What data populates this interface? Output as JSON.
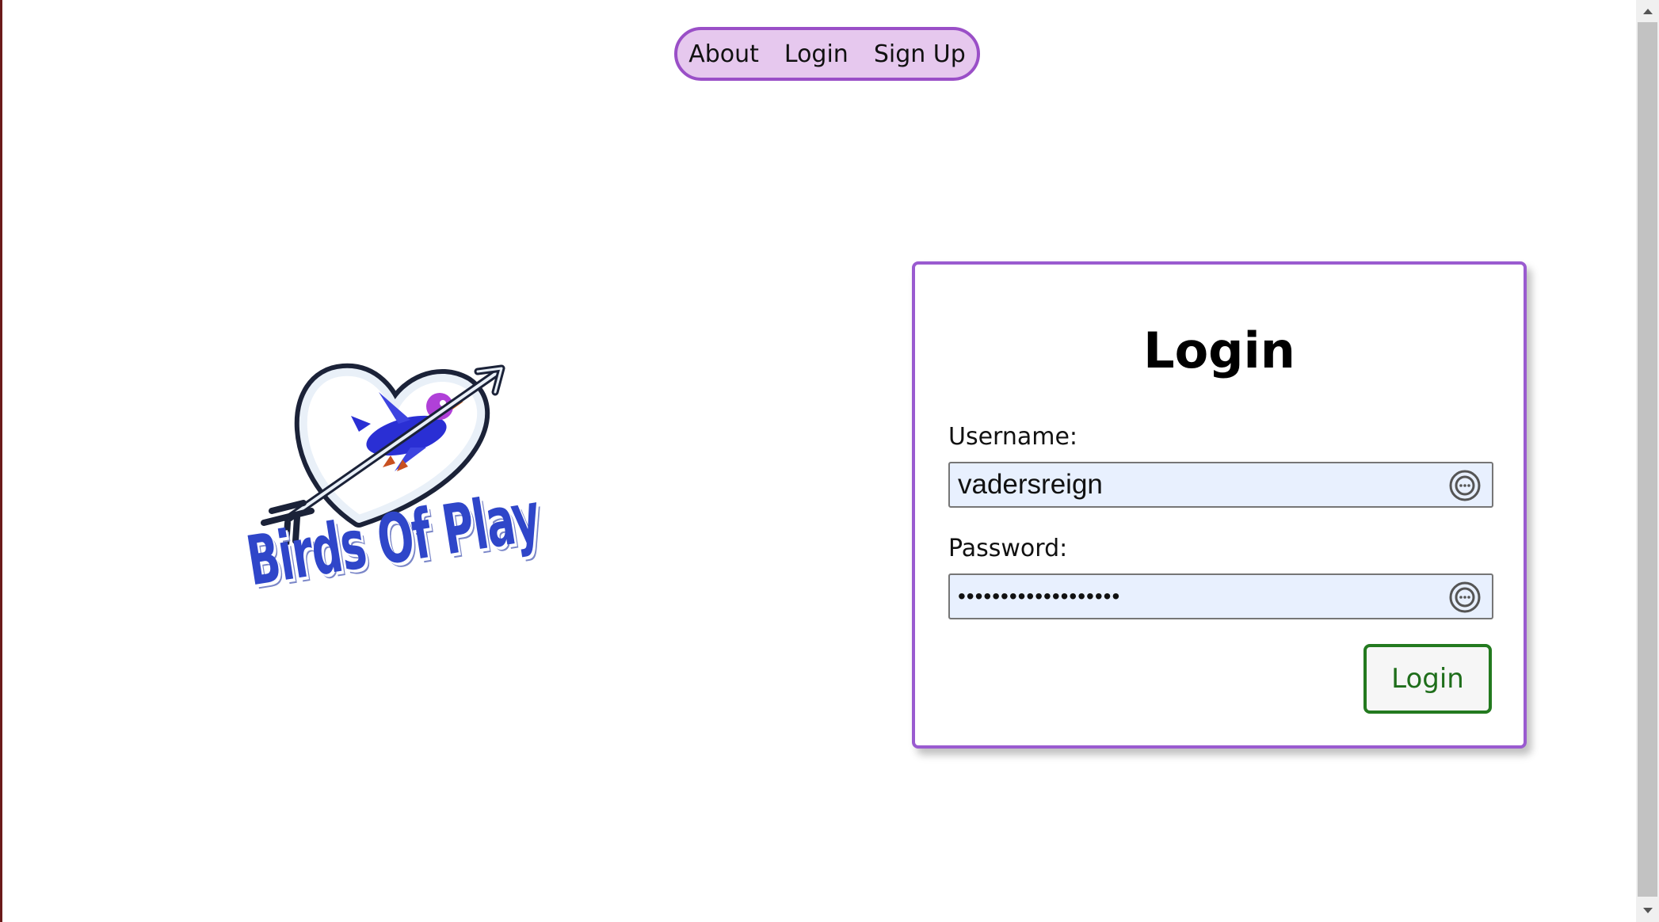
{
  "nav": {
    "items": [
      {
        "label": "About"
      },
      {
        "label": "Login"
      },
      {
        "label": "Sign Up"
      }
    ]
  },
  "logo": {
    "text": "Birds Of Play",
    "icon": "heart-arrow-bird-logo"
  },
  "login_form": {
    "title": "Login",
    "username_label": "Username:",
    "username_value": "vadersreign",
    "password_label": "Password:",
    "password_value": "•••••••••••••••••••",
    "submit_label": "Login"
  },
  "colors": {
    "nav_bg": "#e6c8ee",
    "accent_purple": "#9a4fc7",
    "button_green": "#237a1f",
    "autofill_bg": "#e8f0fe",
    "logo_blue": "#2f46c9"
  }
}
